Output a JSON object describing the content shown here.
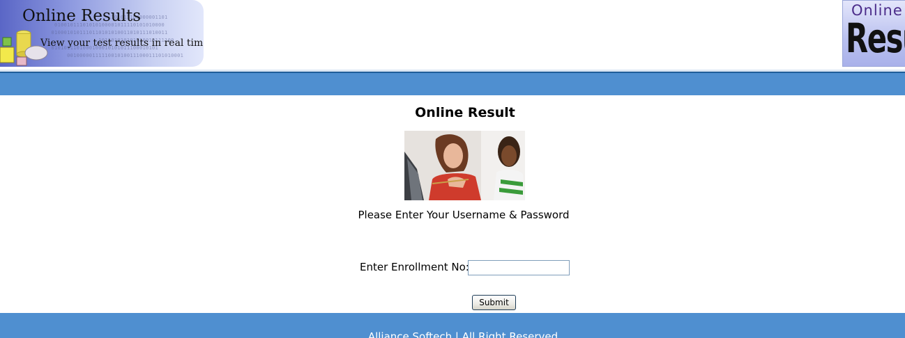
{
  "header": {
    "banner_title": "Online Results",
    "banner_tagline": "View your test results in real time",
    "banner_binary": "                      101011100000001101\n    01001011101010100001011110101010000\n   0100010101110110101010011010111010011\n                  101101010101010010111100\n   0101011101000100010101011100010101\n        0010000011111001010011100011101010001",
    "logo_top_text": "Online",
    "logo_big_text": "Resul"
  },
  "main": {
    "title": "Online Result",
    "instructions": "Please Enter Your Username & Password",
    "enrollment_label": "Enter Enrollment No:",
    "enrollment_value": "",
    "submit_label": "Submit"
  },
  "footer": {
    "text": "Alliance Softech | All Right Reserved"
  },
  "colors": {
    "nav_bar": "#4f8fd0",
    "footer": "#4f8fd0",
    "banner_gradient_start": "#5a66c6"
  }
}
